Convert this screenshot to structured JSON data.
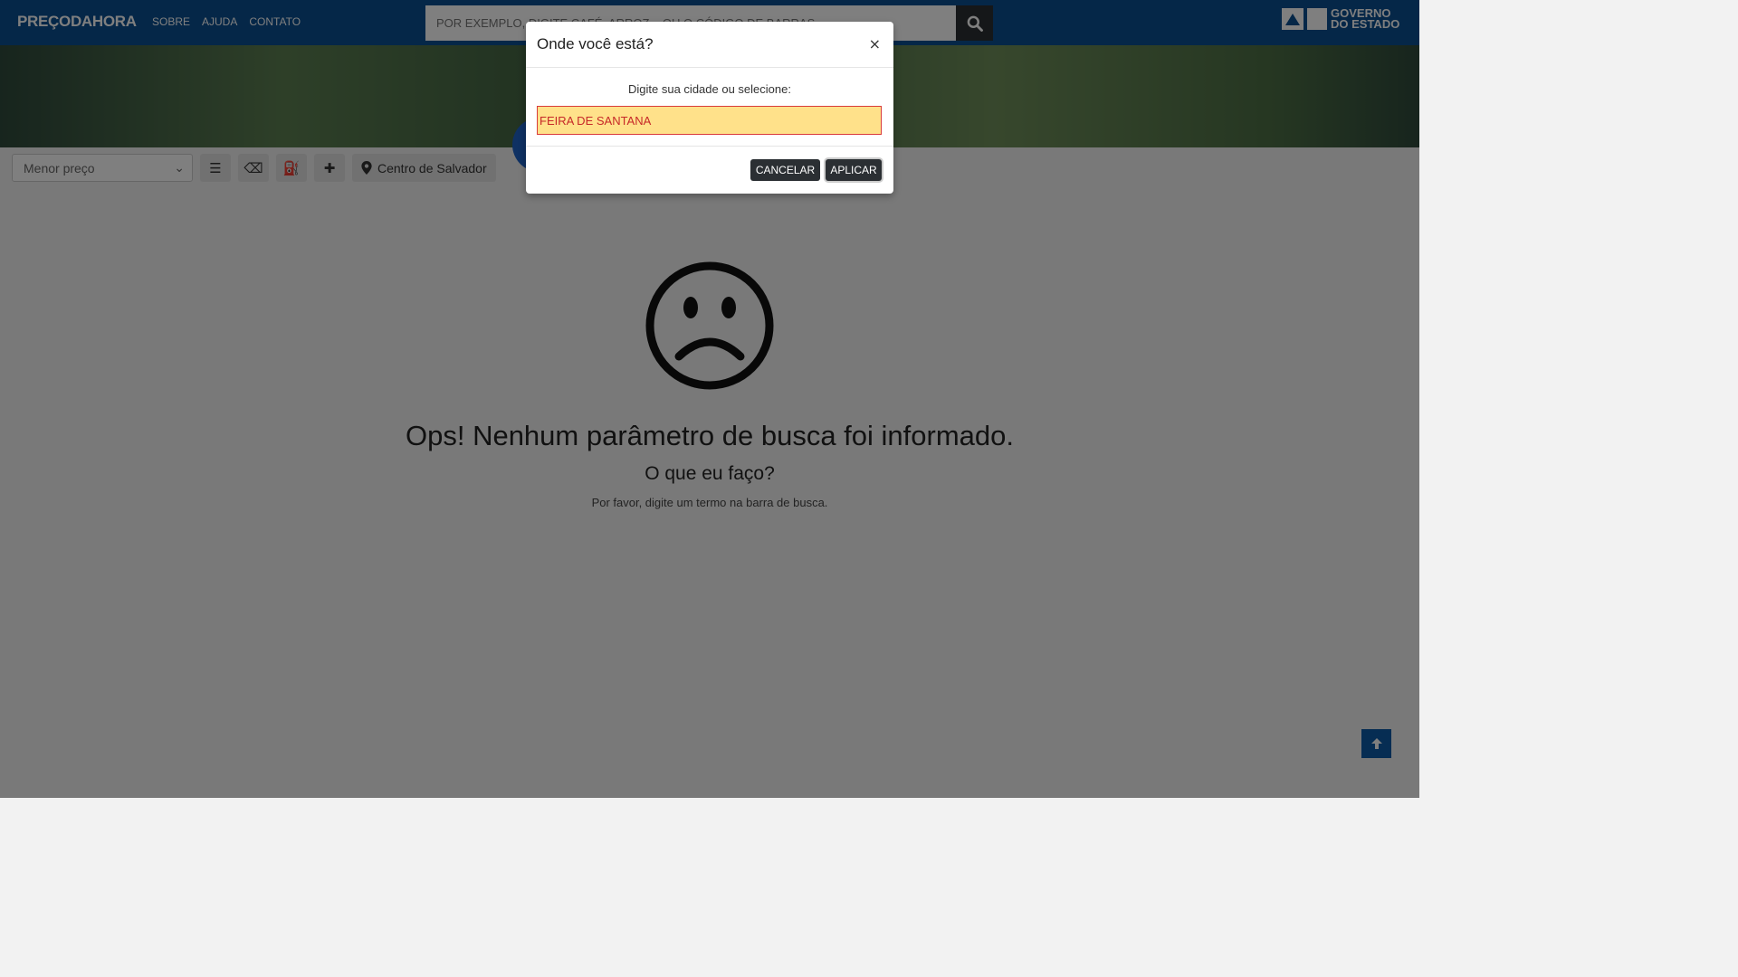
{
  "header": {
    "brand": "PREÇODAHORA",
    "nav": [
      "SOBRE",
      "AJUDA",
      "CONTATO"
    ],
    "search_placeholder": "POR EXEMPLO, DIGITE CAFÉ, ARROZ... OU O CÓDIGO DE BARRAS",
    "gov_logo_lines": [
      "GOVERNO",
      "DO ESTADO"
    ]
  },
  "toolbar": {
    "sort_selected": "Menor preço",
    "location_label": "Centro de Salvador"
  },
  "empty_state": {
    "title": "Ops! Nenhum parâmetro de busca foi informado.",
    "subtitle": "O que eu faço?",
    "hint": "Por favor, digite um termo na barra de busca."
  },
  "modal": {
    "title": "Onde você está?",
    "close": "×",
    "label": "Digite sua cidade ou selecione:",
    "city_value": "FEIRA DE SANTANA",
    "cancel": "CANCELAR",
    "apply": "APLICAR"
  },
  "colors": {
    "navbar": "#0b4f91",
    "input_highlight": "#ffe18a",
    "input_text": "#c62828",
    "dark_button": "#2b2f33"
  }
}
